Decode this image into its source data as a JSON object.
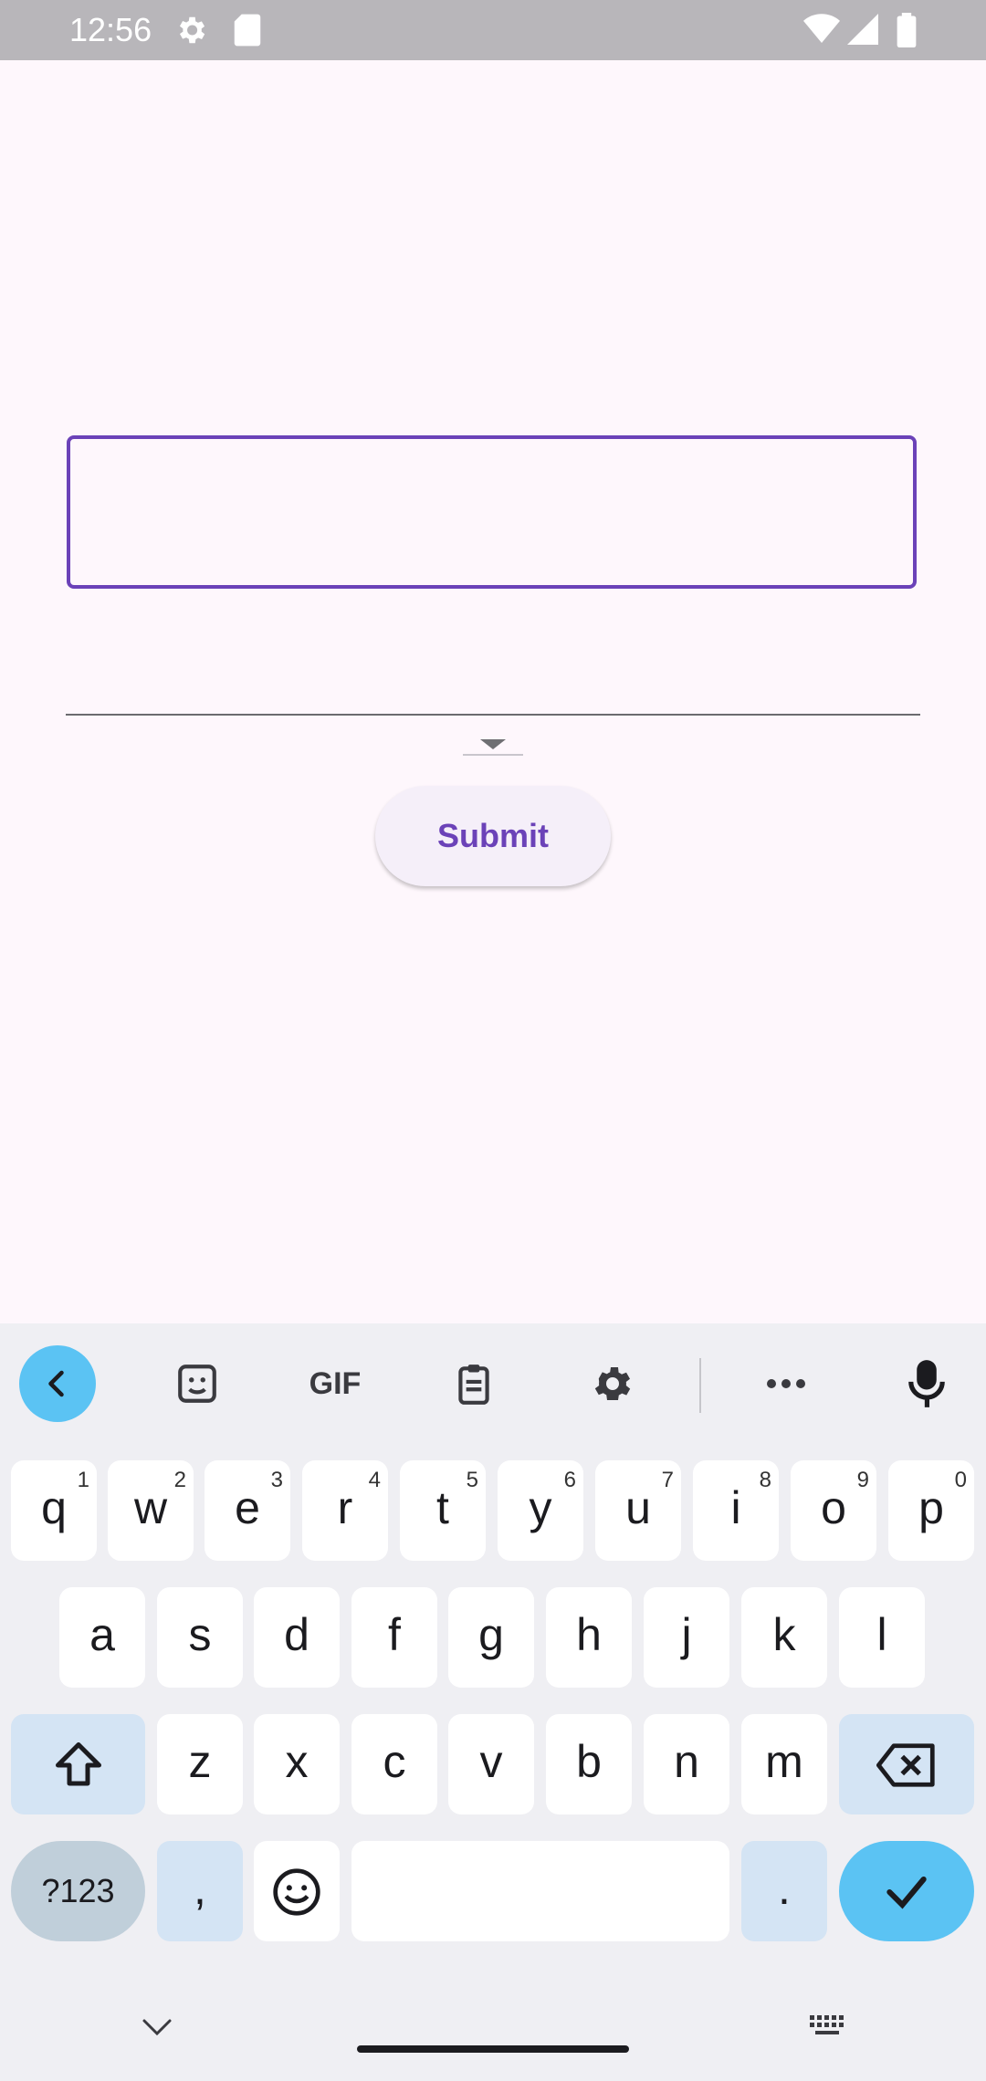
{
  "status_bar": {
    "time": "12:56",
    "icons": [
      "settings-icon",
      "sd-card-icon",
      "wifi-icon",
      "signal-icon",
      "battery-icon"
    ]
  },
  "form": {
    "text_input_value": "",
    "dropdown_value": "",
    "submit_label": "Submit",
    "accent_color": "#6b42b8"
  },
  "keyboard": {
    "toolbar": [
      "back-icon",
      "sticker-icon",
      "gif-icon",
      "clipboard-icon",
      "settings-icon",
      "more-icon",
      "mic-icon"
    ],
    "gif_label": "GIF",
    "row1": [
      {
        "key": "q",
        "hint": "1"
      },
      {
        "key": "w",
        "hint": "2"
      },
      {
        "key": "e",
        "hint": "3"
      },
      {
        "key": "r",
        "hint": "4"
      },
      {
        "key": "t",
        "hint": "5"
      },
      {
        "key": "y",
        "hint": "6"
      },
      {
        "key": "u",
        "hint": "7"
      },
      {
        "key": "i",
        "hint": "8"
      },
      {
        "key": "o",
        "hint": "9"
      },
      {
        "key": "p",
        "hint": "0"
      }
    ],
    "row2": [
      "a",
      "s",
      "d",
      "f",
      "g",
      "h",
      "j",
      "k",
      "l"
    ],
    "row3": [
      "z",
      "x",
      "c",
      "v",
      "b",
      "n",
      "m"
    ],
    "symbols_label": "?123",
    "comma_label": ",",
    "period_label": ".",
    "accent_color": "#5bc3f3"
  }
}
